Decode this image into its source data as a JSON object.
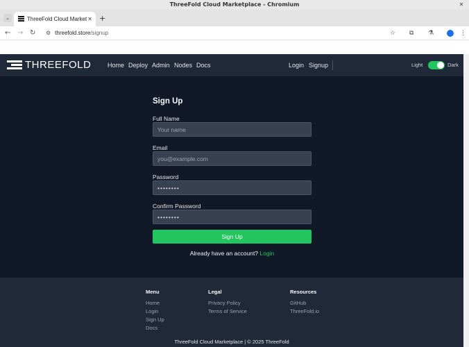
{
  "browser": {
    "window_title": "ThreeFold Cloud Marketplace - Chromium",
    "tab_title": "ThreeFold Cloud Marketplace",
    "url_domain": "threefold.store",
    "url_path": "/signup"
  },
  "nav": {
    "brand": "THREEFOLD",
    "links": [
      "Home",
      "Deploy",
      "Admin",
      "Nodes",
      "Docs"
    ],
    "auth_links": [
      "Login",
      "Signup"
    ],
    "theme_light": "Light",
    "theme_dark": "Dark",
    "theme_is_dark": true
  },
  "form": {
    "title": "Sign Up",
    "full_name_label": "Full Name",
    "full_name_placeholder": "Your name",
    "email_label": "Email",
    "email_placeholder": "you@example.com",
    "password_label": "Password",
    "password_value": "••••••••",
    "confirm_label": "Confirm Password",
    "confirm_value": "••••••••",
    "submit_label": "Sign Up",
    "already_text": "Already have an account?",
    "login_link": "Login"
  },
  "footer": {
    "menu_title": "Menu",
    "menu_links": [
      "Home",
      "Login",
      "Sign Up",
      "Docs"
    ],
    "legal_title": "Legal",
    "legal_links": [
      "Privacy Policy",
      "Terms of Service"
    ],
    "resources_title": "Resources",
    "resources_links": [
      "GitHub",
      "ThreeFold.io"
    ],
    "copyright": "ThreeFold Cloud Marketplace | © 2025 ThreeFold"
  },
  "colors": {
    "accent": "#22c55e",
    "background": "#111827",
    "surface": "#1f2937"
  }
}
